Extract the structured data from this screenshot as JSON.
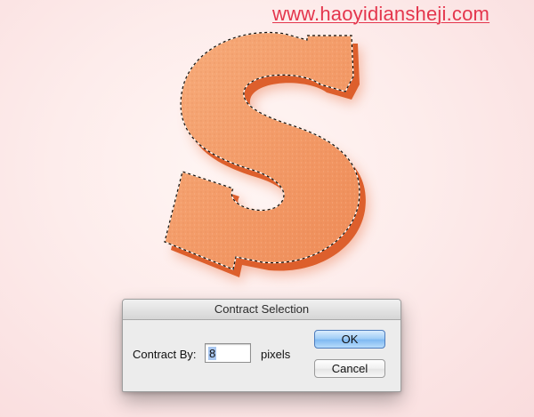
{
  "watermark": {
    "text": "www.haoyidiansheji.com"
  },
  "artwork": {
    "letter": "S",
    "letter_color": "#f39a67",
    "extrusion_color": "#dd5f2c",
    "selection": "marching-ants"
  },
  "dialog": {
    "title": "Contract Selection",
    "field_label": "Contract By:",
    "field_value": "8",
    "unit": "pixels",
    "ok_label": "OK",
    "cancel_label": "Cancel"
  }
}
